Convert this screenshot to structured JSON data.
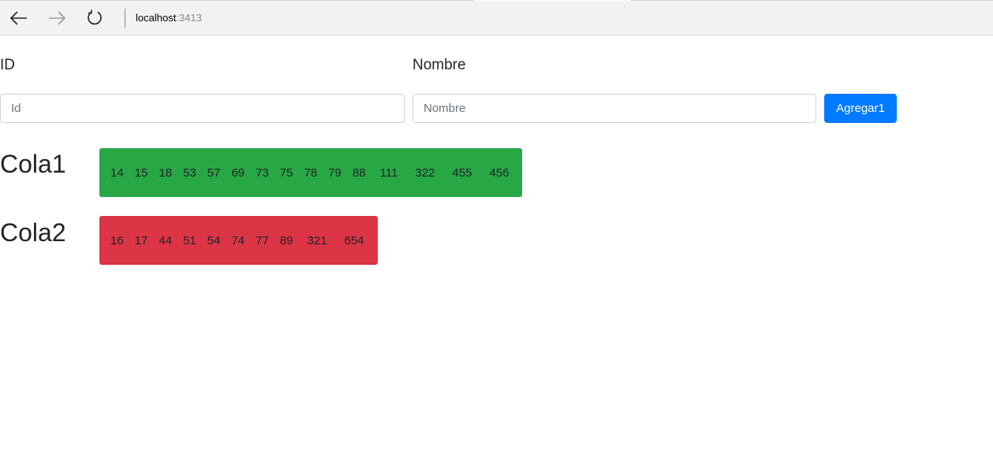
{
  "browser": {
    "host": "localhost",
    "port": ":3413"
  },
  "form": {
    "id_label": "ID",
    "nombre_label": "Nombre",
    "id_placeholder": "Id",
    "nombre_placeholder": "Nombre",
    "add_button": "Agregar1"
  },
  "queues": {
    "cola1": {
      "title": "Cola1",
      "color": "#28a745",
      "items": [
        "14",
        "15",
        "18",
        "53",
        "57",
        "69",
        "73",
        "75",
        "78",
        "79",
        "88",
        "111",
        "322",
        "455",
        "456"
      ]
    },
    "cola2": {
      "title": "Cola2",
      "color": "#dc3545",
      "items": [
        "16",
        "17",
        "44",
        "51",
        "54",
        "74",
        "77",
        "89",
        "321",
        "654"
      ]
    }
  },
  "colors": {
    "primary": "#007bff"
  }
}
